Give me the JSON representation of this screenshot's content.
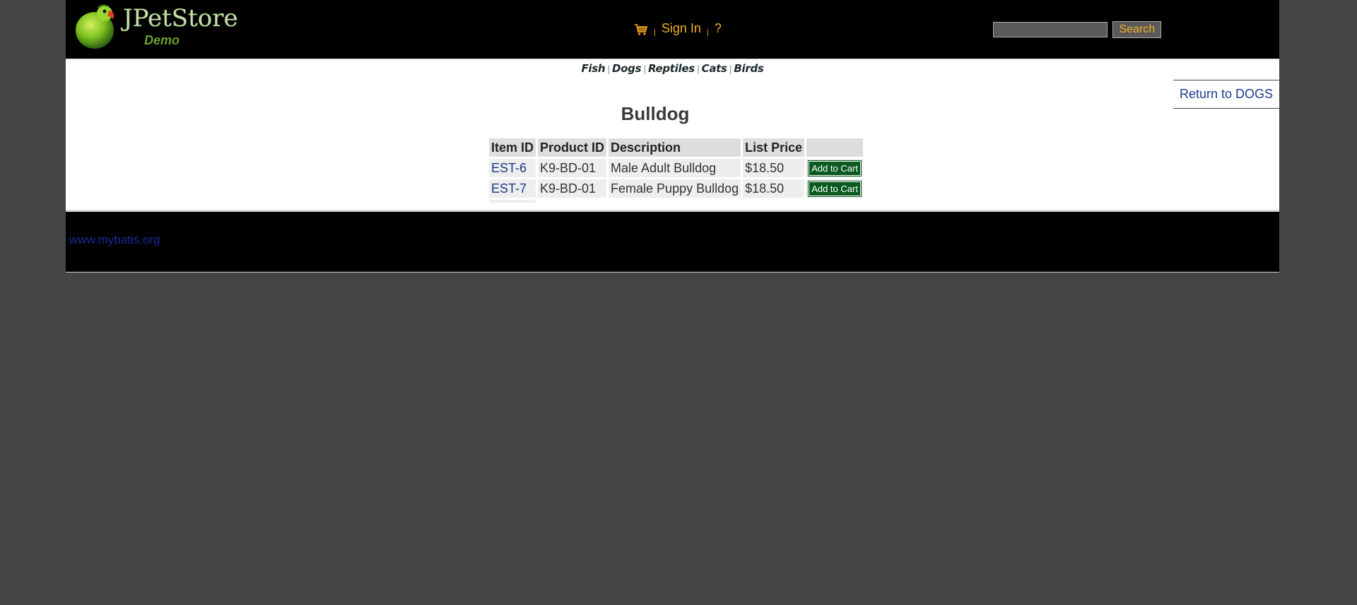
{
  "header": {
    "logo_title": "JPetStore",
    "logo_subtitle": "Demo",
    "menu": {
      "cart_icon": "shopping-cart-icon",
      "separator": "|",
      "sign_in_label": "Sign In",
      "help_label": "?"
    },
    "search": {
      "placeholder": "",
      "value": "",
      "button_label": "Search"
    }
  },
  "quicklinks": {
    "separator": "|",
    "items": [
      {
        "label": "Fish"
      },
      {
        "label": "Dogs"
      },
      {
        "label": "Reptiles"
      },
      {
        "label": "Cats"
      },
      {
        "label": "Birds"
      }
    ]
  },
  "back_link": {
    "label": "Return to DOGS"
  },
  "product": {
    "title": "Bulldog",
    "table": {
      "columns": [
        "Item ID",
        "Product ID",
        "Description",
        "List Price",
        ""
      ],
      "rows": [
        {
          "item_id": "EST-6",
          "product_id": "K9-BD-01",
          "description": "Male Adult Bulldog",
          "price": "$18.50",
          "action": "Add to Cart"
        },
        {
          "item_id": "EST-7",
          "product_id": "K9-BD-01",
          "description": "Female Puppy Bulldog",
          "price": "$18.50",
          "action": "Add to Cart"
        }
      ]
    }
  },
  "footer": {
    "link_label": "www.mybatis.org"
  },
  "colors": {
    "header_bg": "#000000",
    "page_bg": "#444444",
    "menu_link": "#f0b020",
    "link": "#1a3a8a",
    "add_to_cart_bg": "#0a5a20",
    "logo_title": "#c8e0b0",
    "logo_subtitle": "#6aa030"
  }
}
